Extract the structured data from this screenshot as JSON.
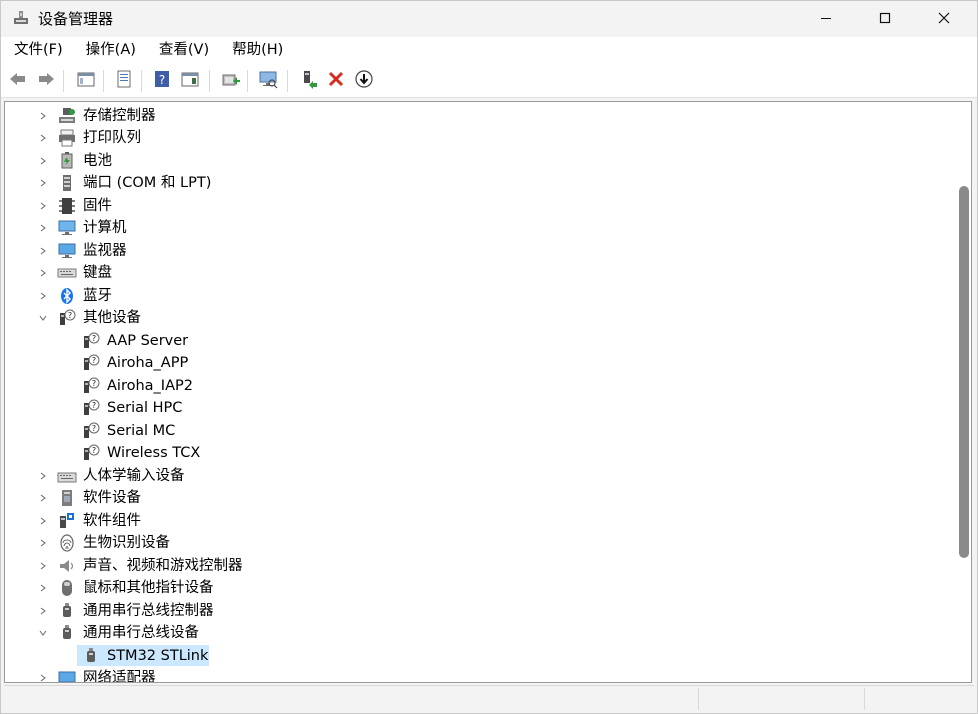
{
  "window": {
    "title": "设备管理器",
    "icon": "device-manager-icon",
    "controls": [
      "minimize-icon",
      "maximize-icon",
      "close-icon"
    ]
  },
  "menu": [
    "文件(F)",
    "操作(A)",
    "查看(V)",
    "帮助(H)"
  ],
  "toolbar": [
    "back-arrow-icon",
    "forward-arrow-icon",
    "show-hide-console-tree-icon",
    "properties-icon",
    "help-icon",
    "action-pane-icon",
    "update-driver-icon",
    "scan-hardware-icon",
    "enable-device-icon",
    "uninstall-device-icon",
    "download-icon"
  ],
  "tree": [
    {
      "label": "存储控制器",
      "icon": "storage-controller-icon",
      "expanded": false,
      "level": 0
    },
    {
      "label": "打印队列",
      "icon": "printer-icon",
      "expanded": false,
      "level": 0
    },
    {
      "label": "电池",
      "icon": "battery-icon",
      "expanded": false,
      "level": 0
    },
    {
      "label": "端口 (COM 和 LPT)",
      "icon": "port-icon",
      "expanded": false,
      "level": 0
    },
    {
      "label": "固件",
      "icon": "firmware-icon",
      "expanded": false,
      "level": 0
    },
    {
      "label": "计算机",
      "icon": "computer-icon",
      "expanded": false,
      "level": 0
    },
    {
      "label": "监视器",
      "icon": "monitor-icon",
      "expanded": false,
      "level": 0
    },
    {
      "label": "键盘",
      "icon": "keyboard-icon",
      "expanded": false,
      "level": 0
    },
    {
      "label": "蓝牙",
      "icon": "bluetooth-icon",
      "expanded": false,
      "level": 0
    },
    {
      "label": "其他设备",
      "icon": "unknown-device-icon",
      "expanded": true,
      "level": 0
    },
    {
      "label": "AAP Server",
      "icon": "unknown-device-icon",
      "level": 1
    },
    {
      "label": "Airoha_APP",
      "icon": "unknown-device-icon",
      "level": 1
    },
    {
      "label": "Airoha_IAP2",
      "icon": "unknown-device-icon",
      "level": 1
    },
    {
      "label": "Serial HPC",
      "icon": "unknown-device-icon",
      "level": 1
    },
    {
      "label": "Serial MC",
      "icon": "unknown-device-icon",
      "level": 1
    },
    {
      "label": "Wireless TCX",
      "icon": "unknown-device-icon",
      "level": 1
    },
    {
      "label": "人体学输入设备",
      "icon": "hid-icon",
      "expanded": false,
      "level": 0
    },
    {
      "label": "软件设备",
      "icon": "software-device-icon",
      "expanded": false,
      "level": 0
    },
    {
      "label": "软件组件",
      "icon": "software-component-icon",
      "expanded": false,
      "level": 0
    },
    {
      "label": "生物识别设备",
      "icon": "biometric-icon",
      "expanded": false,
      "level": 0
    },
    {
      "label": "声音、视频和游戏控制器",
      "icon": "speaker-icon",
      "expanded": false,
      "level": 0
    },
    {
      "label": "鼠标和其他指针设备",
      "icon": "mouse-icon",
      "expanded": false,
      "level": 0
    },
    {
      "label": "通用串行总线控制器",
      "icon": "usb-icon",
      "expanded": false,
      "level": 0
    },
    {
      "label": "通用串行总线设备",
      "icon": "usb-icon",
      "expanded": true,
      "level": 0
    },
    {
      "label": "STM32 STLink",
      "icon": "usb-icon",
      "level": 1,
      "selected": true
    },
    {
      "label": "网络适配器",
      "icon": "network-adapter-icon",
      "expanded": false,
      "level": 0
    }
  ],
  "colors": {
    "selection": "#cce8ff",
    "accent": "#0078d4"
  }
}
